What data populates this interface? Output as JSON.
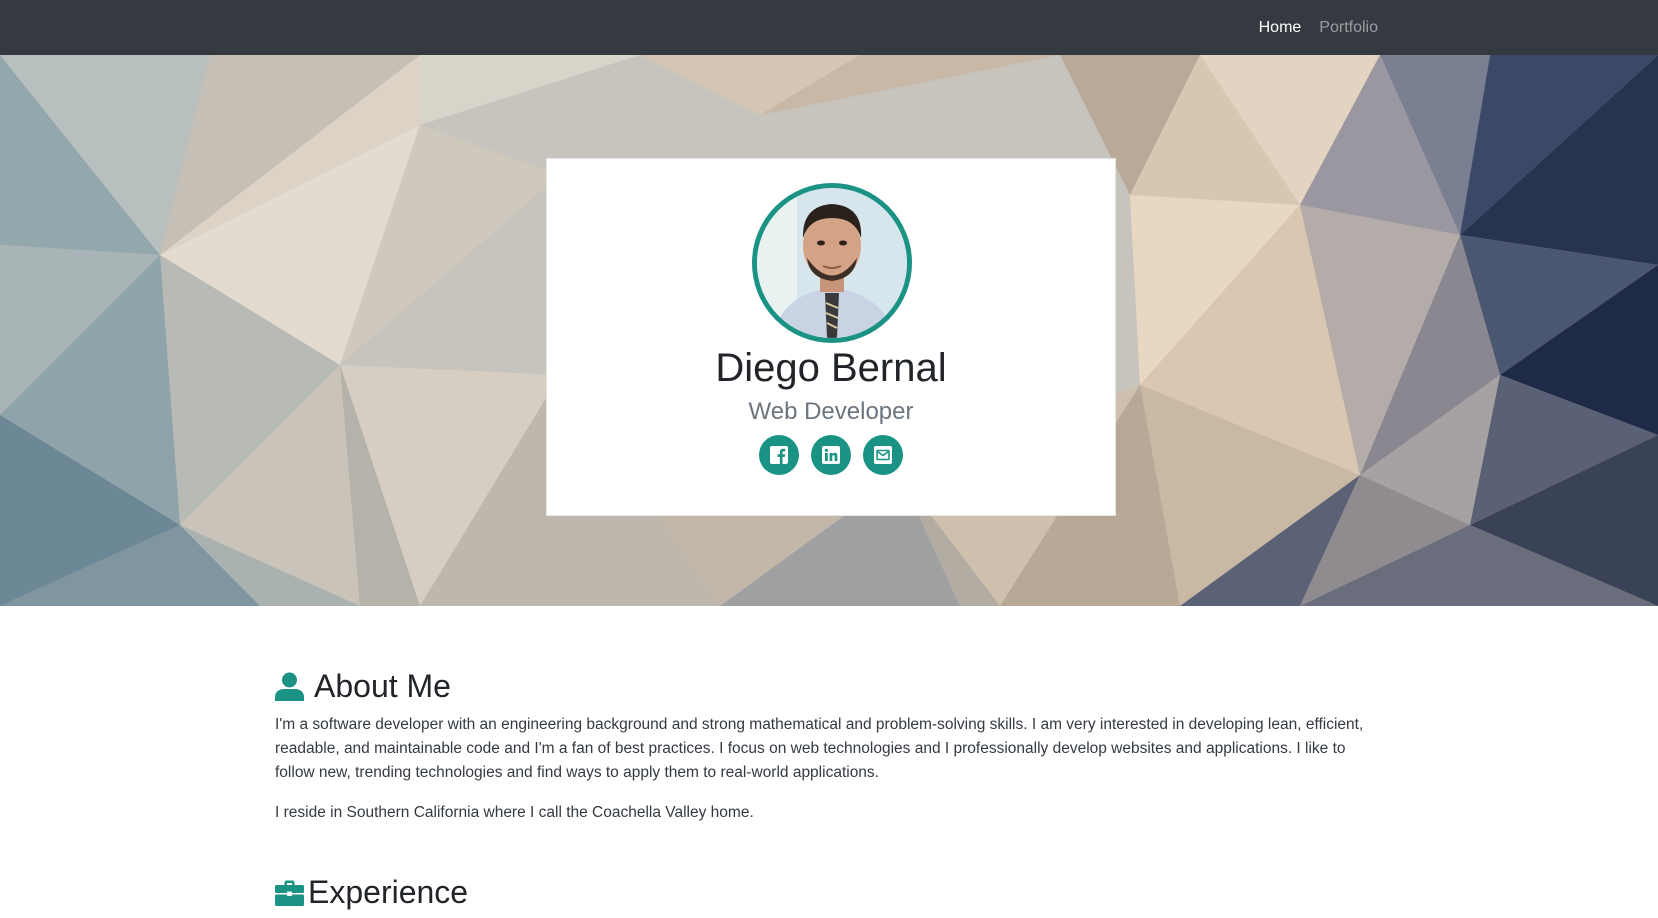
{
  "nav": {
    "links": [
      {
        "label": "Home",
        "active": true
      },
      {
        "label": "Portfolio",
        "active": false
      }
    ]
  },
  "profile": {
    "name": "Diego Bernal",
    "role": "Web Developer",
    "social_icons": [
      "facebook-icon",
      "linkedin-icon",
      "email-icon"
    ]
  },
  "about": {
    "heading": "About Me",
    "icon": "user-icon",
    "paragraphs": [
      "I'm a software developer with an engineering background and strong mathematical and problem-solving skills. I am very interested in developing lean, efficient, readable, and maintainable code and I'm a fan of best practices. I focus on web technologies and I professionally develop websites and applications. I like to follow new, trending technologies and find ways to apply them to real-world applications.",
      "I reside in Southern California where I call the Coachella Valley home."
    ]
  },
  "experience": {
    "heading": "Experience",
    "icon": "briefcase-icon"
  },
  "colors": {
    "navbar": "#343a40",
    "accent": "#1a9384",
    "muted_text": "#6c757d"
  }
}
